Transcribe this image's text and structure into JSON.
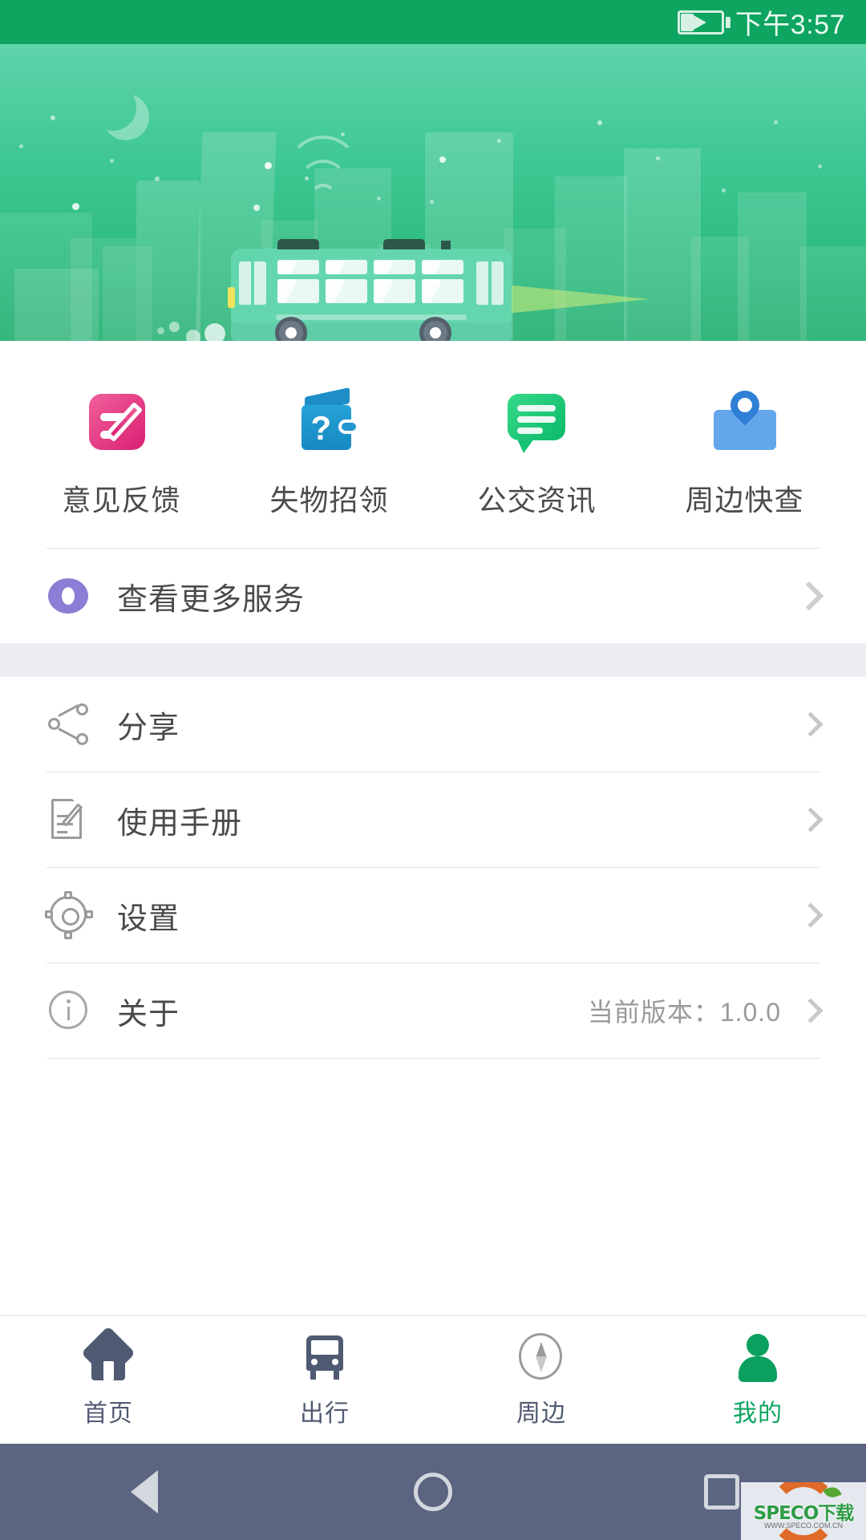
{
  "status_bar": {
    "time": "下午3:57",
    "battery_icon": "battery-charging-icon"
  },
  "hero": {
    "illustration": "night-city-bus-banner"
  },
  "services": [
    {
      "label": "意见反馈",
      "icon": "feedback-pencil-icon",
      "color": "#d81f72"
    },
    {
      "label": "失物招领",
      "icon": "wallet-question-icon",
      "color": "#1588c2"
    },
    {
      "label": "公交资讯",
      "icon": "chat-bubble-icon",
      "color": "#0bb96a"
    },
    {
      "label": "周边快查",
      "icon": "map-pin-icon",
      "color": "#2f7fd6"
    }
  ],
  "more_services": {
    "label": "查看更多服务",
    "icon": "eye-icon",
    "chevron": "chevron-right-icon"
  },
  "menu": [
    {
      "label": "分享",
      "icon": "share-icon",
      "meta": "",
      "chevron": "chevron-right-icon"
    },
    {
      "label": "使用手册",
      "icon": "manual-icon",
      "meta": "",
      "chevron": "chevron-right-icon"
    },
    {
      "label": "设置",
      "icon": "gear-icon",
      "meta": "",
      "chevron": "chevron-right-icon"
    },
    {
      "label": "关于",
      "icon": "info-icon",
      "meta": "当前版本：1.0.0",
      "chevron": "chevron-right-icon"
    }
  ],
  "tabs": [
    {
      "label": "首页",
      "icon": "home-icon",
      "active": false
    },
    {
      "label": "出行",
      "icon": "bus-icon",
      "active": false
    },
    {
      "label": "周边",
      "icon": "compass-icon",
      "active": false
    },
    {
      "label": "我的",
      "icon": "person-icon",
      "active": true
    }
  ],
  "android_nav": {
    "back": "back-triangle-icon",
    "home": "home-circle-icon",
    "recents": "recents-square-icon"
  },
  "watermark": {
    "text": "SPECO下载",
    "url": "WWW.SPECO.COM.CN"
  }
}
